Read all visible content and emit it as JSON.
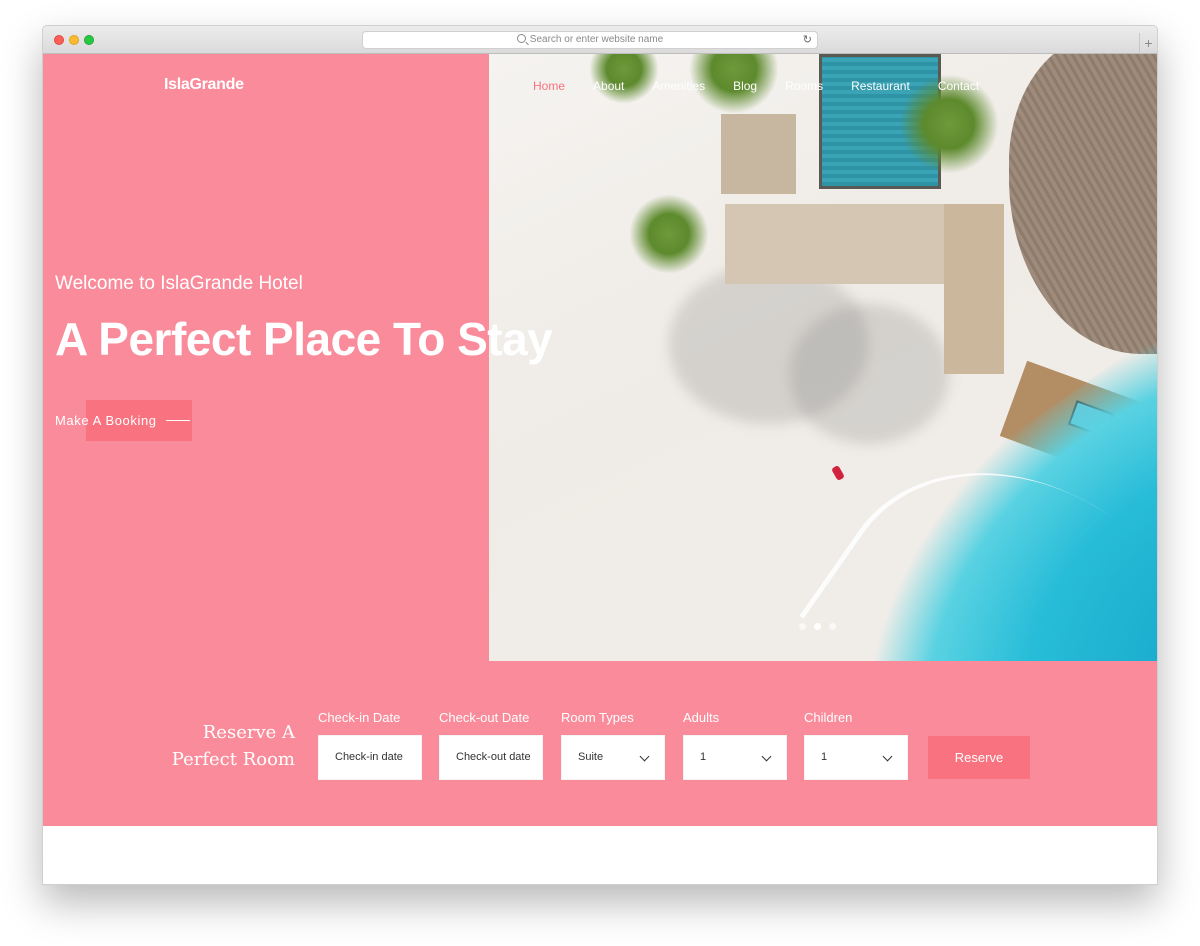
{
  "browser": {
    "url_placeholder": "Search or enter website name",
    "reload_icon": "↻",
    "new_tab_icon": "+"
  },
  "site": {
    "brand": "IslaGrande",
    "nav": [
      {
        "label": "Home",
        "active": true
      },
      {
        "label": "About"
      },
      {
        "label": "Amenities"
      },
      {
        "label": "Blog"
      },
      {
        "label": "Rooms"
      },
      {
        "label": "Restaurant"
      },
      {
        "label": "Contact"
      }
    ]
  },
  "hero": {
    "welcome": "Welcome to IslaGrande Hotel",
    "headline": "A Perfect Place To Stay",
    "cta": "Make A Booking",
    "slider_dots": 3,
    "active_dot": 2
  },
  "reservation": {
    "title_line1": "Reserve A",
    "title_line2": "Perfect Room",
    "fields": [
      {
        "label": "Check-in Date",
        "placeholder": "Check-in date"
      },
      {
        "label": "Check-out Date",
        "placeholder": "Check-out date"
      },
      {
        "label": "Room Types",
        "value": "Suite"
      },
      {
        "label": "Adults",
        "value": "1"
      },
      {
        "label": "Children",
        "value": "1"
      }
    ],
    "submit": "Reserve"
  },
  "colors": {
    "accent": "#f9727f",
    "hero_background": "#fa8b9a"
  }
}
